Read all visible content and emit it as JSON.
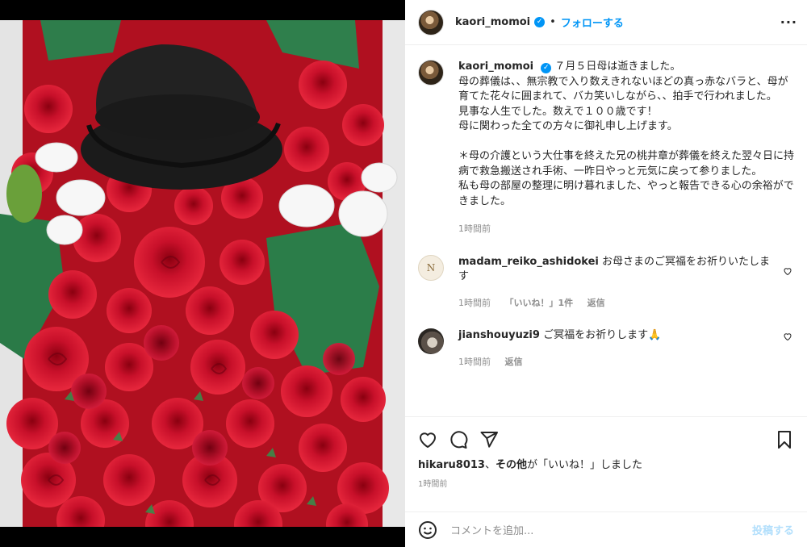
{
  "post": {
    "username": "kaori_momoi",
    "follow_label": "フォローする",
    "dot": "•",
    "more_icon": "more-horizontal-icon",
    "caption_first": "７月５日母は逝きました。",
    "caption_rest": "母の葬儀は、、無宗教で入り数えきれないほどの真っ赤なバラと、母が育てた花々に囲まれて、バカ笑いしながら、、拍手で行われました。\n見事な人生でした。数えで１００歳です！\n母に関わった全ての方々に御礼申し上げます。\n\n＊母の介護という大仕事を終えた兄の桃井章が葬儀を終えた翌々日に持病で救急搬送され手術、一昨日やっと元気に戻って参りました。\n私も母の部屋の整理に明け暮れました、やっと報告できる心の余裕ができました。",
    "caption_time": "1時間前",
    "image_alt": "red-roses-and-black-hat-photo"
  },
  "comments": [
    {
      "username": "madam_reiko_ashidokei",
      "text": "お母さまのご冥福をお祈りいたします",
      "time": "1時間前",
      "likes": "「いいね！」1件",
      "reply": "返信",
      "avatar_text": "N"
    },
    {
      "username": "jianshouyuzi9",
      "text": "ご冥福をお祈りします🙏",
      "time": "1時間前",
      "reply": "返信"
    }
  ],
  "actions": {
    "liked_by_user": "hikaru8013",
    "liked_by_sep": "、",
    "liked_by_others": "その他",
    "liked_by_suffix": "が「いいね！」しました",
    "time": "1時間前"
  },
  "add_comment": {
    "placeholder": "コメントを追加...",
    "post_label": "投稿する"
  },
  "colors": {
    "accent": "#0095f6",
    "muted": "#8e8e8e",
    "post_disabled": "#b2dffc"
  }
}
